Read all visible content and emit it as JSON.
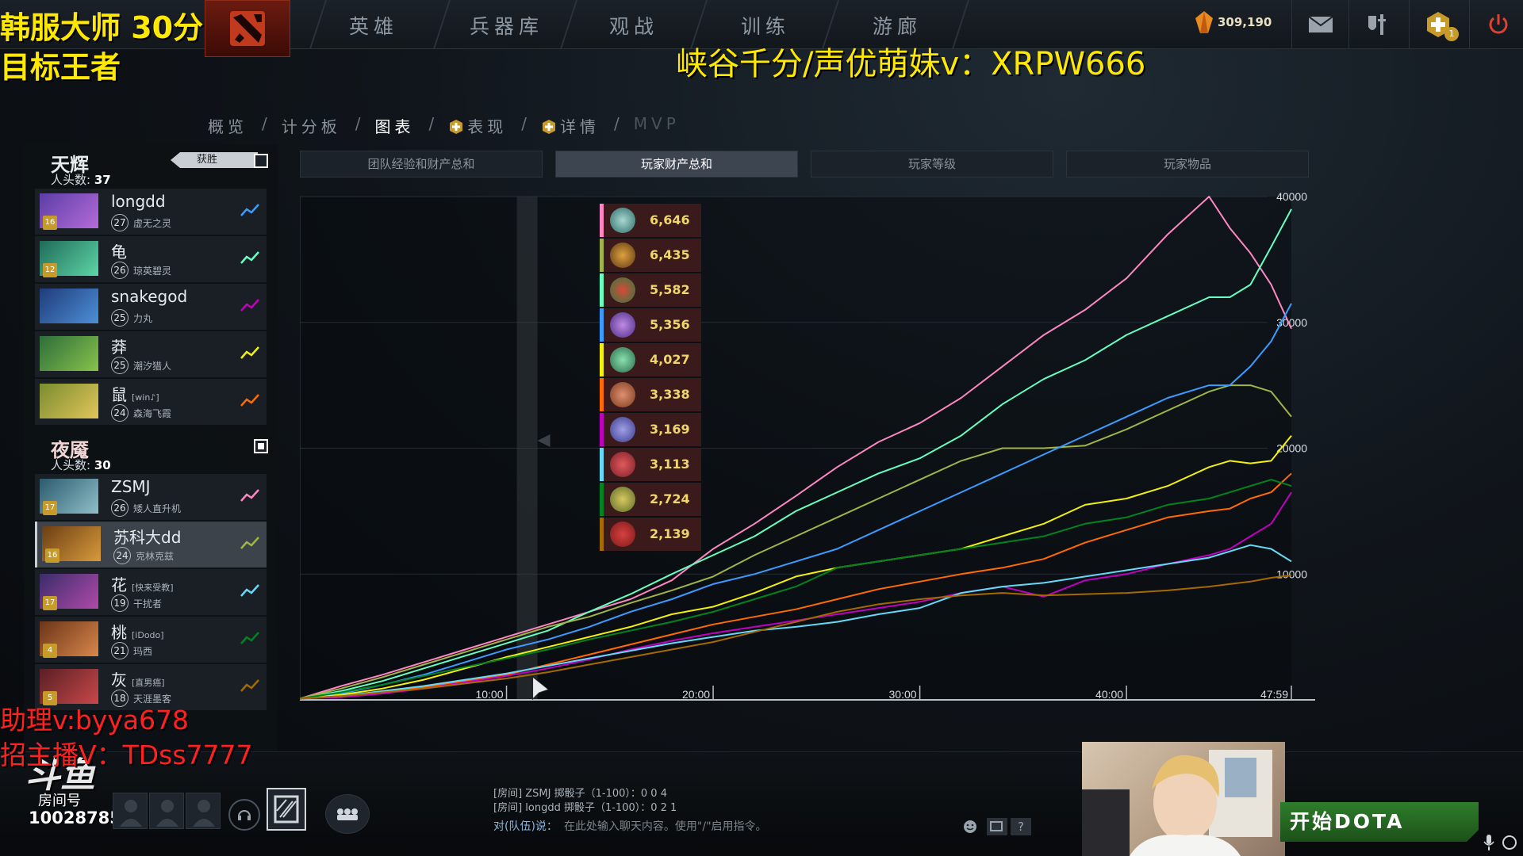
{
  "overlay": {
    "line1": "韩服大师 30分",
    "line2": "目标王者",
    "promo": "峡谷千分/声优萌妹v：XRPW666",
    "assistant": "助理v:byya678",
    "recruit": "招主播V：TDss7777",
    "platform": "斗鱼",
    "room_label": "房间号",
    "room_id": "10028785"
  },
  "topnav": {
    "items": [
      "英雄",
      "兵器库",
      "观战",
      "训练",
      "游廊"
    ],
    "currency": "309,190",
    "notification_count": "1"
  },
  "subnav": {
    "items": [
      "概览",
      "计分板",
      "图表",
      "表现",
      "详情",
      "MVP"
    ],
    "active": "图表"
  },
  "radiant": {
    "name": "天辉",
    "kills_label": "人头数:",
    "kills": "37",
    "win_label": "获胜",
    "players": [
      {
        "name": "longdd",
        "tag": "",
        "level": "27",
        "hero": "虚无之灵",
        "badge": "16",
        "color": "#3c9bff",
        "portrait": [
          "#5b3ea6",
          "#b56bd8"
        ]
      },
      {
        "name": "龟",
        "tag": "",
        "level": "26",
        "hero": "琼英碧灵",
        "badge": "12",
        "color": "#66ffbf",
        "portrait": [
          "#1f6b58",
          "#5ed6a8"
        ]
      },
      {
        "name": "snakegod",
        "tag": "",
        "level": "25",
        "hero": "力丸",
        "badge": "",
        "color": "#bf00bf",
        "portrait": [
          "#1f3c7a",
          "#4d8fd6"
        ]
      },
      {
        "name": "莽",
        "tag": "",
        "level": "25",
        "hero": "潮汐猎人",
        "badge": "",
        "color": "#f3f00b",
        "portrait": [
          "#2d6e3a",
          "#88c24c"
        ]
      },
      {
        "name": "鼠",
        "tag": "[win♪]",
        "level": "24",
        "hero": "森海飞霞",
        "badge": "",
        "color": "#ff6b00",
        "portrait": [
          "#7a8c2e",
          "#e1c65a"
        ]
      }
    ]
  },
  "dire": {
    "name": "夜魇",
    "kills_label": "人头数:",
    "kills": "30",
    "players": [
      {
        "name": "ZSMJ",
        "tag": "",
        "level": "26",
        "hero": "矮人直升机",
        "badge": "17",
        "color": "#fe86c2",
        "portrait": [
          "#2c5a6e",
          "#8ec0c8"
        ]
      },
      {
        "name": "苏科大dd",
        "tag": "",
        "level": "24",
        "hero": "克林克兹",
        "badge": "16",
        "color": "#a1b447",
        "portrait": [
          "#6b3e14",
          "#d89a3c"
        ]
      },
      {
        "name": "花",
        "tag": "[快来受教]",
        "level": "19",
        "hero": "干扰者",
        "badge": "17",
        "color": "#65d9f7",
        "portrait": [
          "#3a2c6b",
          "#b04aa8"
        ]
      },
      {
        "name": "桃",
        "tag": "[iDodo]",
        "level": "21",
        "hero": "玛西",
        "badge": "4",
        "color": "#008321",
        "portrait": [
          "#6b3418",
          "#d8874a"
        ]
      },
      {
        "name": "灰",
        "tag": "[直男癌]",
        "level": "18",
        "hero": "天涯墨客",
        "badge": "5",
        "color": "#a46900",
        "portrait": [
          "#5a1f24",
          "#c8484a"
        ]
      }
    ]
  },
  "chart_tabs": [
    "团队经验和财产总和",
    "玩家财产总和",
    "玩家等级",
    "玩家物品"
  ],
  "chart_tab_active": "玩家财产总和",
  "networth_list": [
    {
      "value": "6,646",
      "color": "#fe86c2",
      "icon": [
        "#2e6b6a",
        "#a8d8d0"
      ]
    },
    {
      "value": "6,435",
      "color": "#a1b447",
      "icon": [
        "#5a3a12",
        "#e0a040"
      ]
    },
    {
      "value": "5,582",
      "color": "#66ffbf",
      "icon": [
        "#2c7a3e",
        "#d84a3a"
      ]
    },
    {
      "value": "5,356",
      "color": "#3c9bff",
      "icon": [
        "#4a2c8a",
        "#c08ae0"
      ]
    },
    {
      "value": "4,027",
      "color": "#f3f00b",
      "icon": [
        "#2a6a4a",
        "#8ae0b0"
      ]
    },
    {
      "value": "3,338",
      "color": "#ff6b00",
      "icon": [
        "#7a3a1e",
        "#e09070"
      ]
    },
    {
      "value": "3,169",
      "color": "#bf00bf",
      "icon": [
        "#3a3a8a",
        "#a0a0e8"
      ]
    },
    {
      "value": "3,113",
      "color": "#65d9f7",
      "icon": [
        "#7a1e2a",
        "#e05a5a"
      ]
    },
    {
      "value": "2,724",
      "color": "#008321",
      "icon": [
        "#5a6a2a",
        "#d8c860"
      ]
    },
    {
      "value": "2,139",
      "color": "#a46900",
      "icon": [
        "#7a1a1a",
        "#d84040"
      ]
    }
  ],
  "chart_data": {
    "type": "line",
    "x_ticks": [
      "10:00",
      "20:00",
      "30:00",
      "40:00",
      "47:59"
    ],
    "x_tick_values": [
      10,
      20,
      30,
      40,
      47.98
    ],
    "xlim": [
      0,
      47.98
    ],
    "y_ticks": [
      "10000",
      "20000",
      "30000",
      "40000"
    ],
    "y_tick_values": [
      10000,
      20000,
      30000,
      40000
    ],
    "ylim": [
      0,
      40000
    ],
    "x": [
      0,
      2,
      4,
      6,
      8,
      10,
      12,
      14,
      16,
      18,
      20,
      22,
      24,
      26,
      28,
      30,
      32,
      34,
      36,
      38,
      40,
      42,
      44,
      45,
      46,
      47,
      48
    ],
    "series": [
      {
        "color": "#fe86c2",
        "values": [
          100,
          1100,
          2000,
          3000,
          4000,
          5000,
          6000,
          7000,
          8000,
          9500,
          12000,
          14000,
          16200,
          18500,
          20500,
          22000,
          24000,
          26500,
          29000,
          31000,
          33500,
          37000,
          40000,
          37500,
          35500,
          33000,
          29500
        ]
      },
      {
        "color": "#66ffbf",
        "values": [
          100,
          700,
          1500,
          2500,
          3500,
          4500,
          5500,
          7000,
          8400,
          10000,
          11500,
          13000,
          15000,
          16500,
          18000,
          19200,
          21000,
          23500,
          25500,
          27000,
          29000,
          30500,
          32000,
          32000,
          33000,
          36000,
          39000
        ]
      },
      {
        "color": "#a1b447",
        "values": [
          100,
          900,
          1800,
          2800,
          3800,
          4800,
          5800,
          6600,
          7700,
          8700,
          9800,
          11500,
          13000,
          14500,
          16000,
          17500,
          19000,
          20000,
          20000,
          20200,
          21500,
          23000,
          24500,
          25000,
          25000,
          24500,
          22500
        ]
      },
      {
        "color": "#3c9bff",
        "values": [
          100,
          500,
          1200,
          2000,
          3000,
          4000,
          4800,
          5800,
          7000,
          8000,
          9200,
          10000,
          11000,
          12000,
          13500,
          15000,
          16500,
          18000,
          19500,
          21000,
          22500,
          24000,
          25000,
          25000,
          26500,
          28500,
          31500
        ]
      },
      {
        "color": "#f3f00b",
        "values": [
          100,
          400,
          900,
          1600,
          2500,
          3400,
          4200,
          5000,
          5800,
          6800,
          7400,
          8500,
          9800,
          10500,
          11000,
          11500,
          12000,
          13000,
          14000,
          15500,
          16000,
          17000,
          18500,
          19000,
          18800,
          19000,
          21000
        ]
      },
      {
        "color": "#ff6b00",
        "values": [
          100,
          300,
          600,
          1000,
          1500,
          2000,
          2800,
          3600,
          4400,
          5200,
          6000,
          6600,
          7200,
          8000,
          8800,
          9400,
          10000,
          10500,
          11200,
          12500,
          13500,
          14500,
          15000,
          15200,
          16000,
          16500,
          18000
        ]
      },
      {
        "color": "#bf00bf",
        "values": [
          100,
          200,
          500,
          900,
          1400,
          1900,
          2500,
          3200,
          4000,
          4700,
          5300,
          5800,
          6300,
          6800,
          7300,
          7800,
          8500,
          9000,
          8200,
          9500,
          10000,
          10800,
          11500,
          12000,
          13000,
          14000,
          16500
        ]
      },
      {
        "color": "#65d9f7",
        "values": [
          100,
          300,
          700,
          1100,
          1600,
          2100,
          2700,
          3300,
          3900,
          4500,
          5000,
          5500,
          5800,
          6200,
          6800,
          7300,
          8500,
          9000,
          9300,
          9800,
          10300,
          10800,
          11300,
          11800,
          12300,
          12000,
          11000
        ]
      },
      {
        "color": "#008321",
        "values": [
          100,
          600,
          1200,
          1900,
          2600,
          3300,
          4000,
          4800,
          5500,
          6200,
          7000,
          8000,
          9000,
          10500,
          11000,
          11500,
          12000,
          12500,
          13000,
          14000,
          14500,
          15500,
          16000,
          16500,
          17000,
          17500,
          17000
        ]
      },
      {
        "color": "#a46900",
        "values": [
          100,
          300,
          600,
          900,
          1300,
          1700,
          2200,
          2800,
          3400,
          4000,
          4600,
          5400,
          6200,
          7000,
          7600,
          8000,
          8300,
          8500,
          8300,
          8400,
          8500,
          8700,
          9000,
          9200,
          9400,
          9700,
          9900
        ]
      }
    ]
  },
  "chat": {
    "line1": "[房间] ZSMJ 掷骰子（1-100）：0 0 4",
    "line2": "[房间] longdd 掷骰子（1-100）：0 2 1",
    "prefix": "对(队伍)说：",
    "placeholder": "在此处输入聊天内容。使用\"/\"启用指令。"
  },
  "play_button": "开始DOTA"
}
